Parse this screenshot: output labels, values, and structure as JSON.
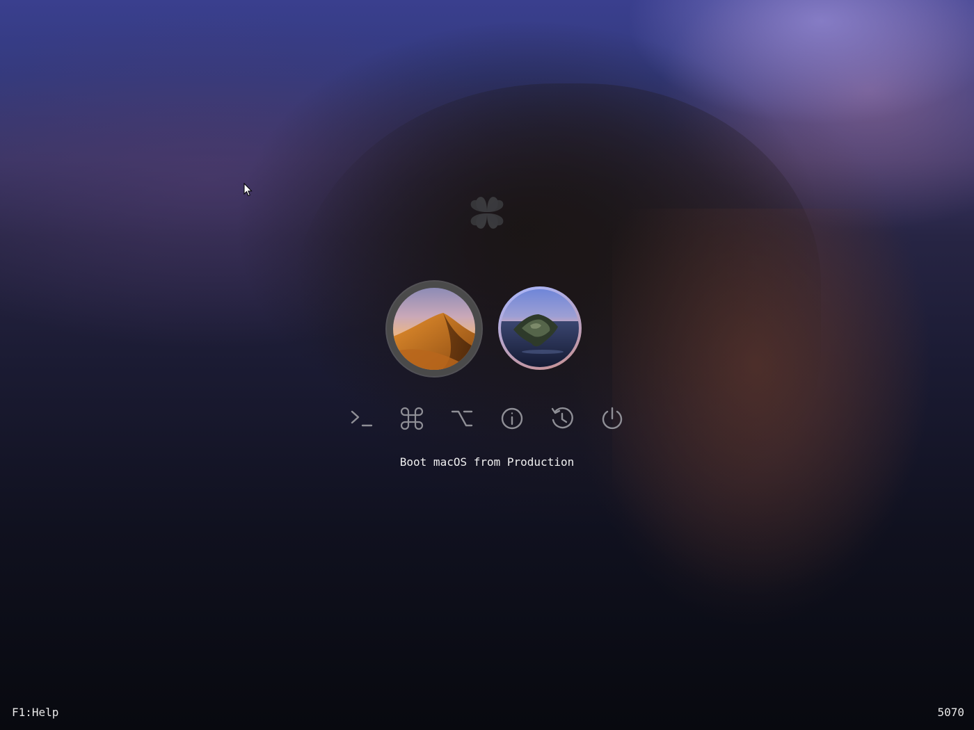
{
  "boot_menu": {
    "entries": [
      {
        "name": "macOS Mojave",
        "volume": "Production",
        "selected": true,
        "icon": "mojave-disk-icon"
      },
      {
        "name": "macOS Catalina",
        "selected": false,
        "icon": "catalina-disk-icon"
      }
    ],
    "selected_label": "Boot macOS from Production"
  },
  "tools": [
    {
      "name": "shell",
      "icon": "terminal-icon"
    },
    {
      "name": "command",
      "icon": "command-key-icon"
    },
    {
      "name": "option",
      "icon": "option-key-icon"
    },
    {
      "name": "info",
      "icon": "info-icon"
    },
    {
      "name": "reset",
      "icon": "reset-icon"
    },
    {
      "name": "shutdown",
      "icon": "power-icon"
    }
  ],
  "footer": {
    "help": "F1:Help",
    "countdown": "5070"
  },
  "colors": {
    "icon_gray": "#8f8f96",
    "text": "#f0f0f0"
  }
}
